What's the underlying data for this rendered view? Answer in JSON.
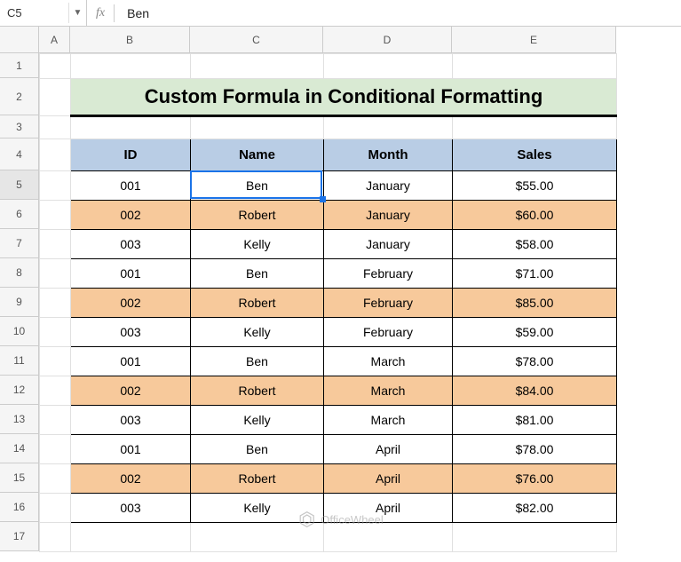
{
  "nameBox": "C5",
  "formulaValue": "Ben",
  "fxLabel": "fx",
  "columns": [
    {
      "label": "A",
      "width": 35
    },
    {
      "label": "B",
      "width": 135
    },
    {
      "label": "C",
      "width": 150
    },
    {
      "label": "D",
      "width": 145
    },
    {
      "label": "E",
      "width": 185
    }
  ],
  "rows": [
    {
      "label": "1",
      "height": 28
    },
    {
      "label": "2",
      "height": 42
    },
    {
      "label": "3",
      "height": 26
    },
    {
      "label": "4",
      "height": 36
    },
    {
      "label": "5",
      "height": 33,
      "active": true
    },
    {
      "label": "6",
      "height": 33
    },
    {
      "label": "7",
      "height": 33
    },
    {
      "label": "8",
      "height": 33
    },
    {
      "label": "9",
      "height": 33
    },
    {
      "label": "10",
      "height": 33
    },
    {
      "label": "11",
      "height": 33
    },
    {
      "label": "12",
      "height": 33
    },
    {
      "label": "13",
      "height": 33
    },
    {
      "label": "14",
      "height": 33
    },
    {
      "label": "15",
      "height": 33
    },
    {
      "label": "16",
      "height": 33
    },
    {
      "label": "17",
      "height": 33
    }
  ],
  "title": "Custom Formula in Conditional Formatting",
  "tableHeaders": [
    "ID",
    "Name",
    "Month",
    "Sales"
  ],
  "tableData": [
    {
      "id": "001",
      "name": "Ben",
      "month": "January",
      "sales": "$55.00",
      "hl": false
    },
    {
      "id": "002",
      "name": "Robert",
      "month": "January",
      "sales": "$60.00",
      "hl": true
    },
    {
      "id": "003",
      "name": "Kelly",
      "month": "January",
      "sales": "$58.00",
      "hl": false
    },
    {
      "id": "001",
      "name": "Ben",
      "month": "February",
      "sales": "$71.00",
      "hl": false
    },
    {
      "id": "002",
      "name": "Robert",
      "month": "February",
      "sales": "$85.00",
      "hl": true
    },
    {
      "id": "003",
      "name": "Kelly",
      "month": "February",
      "sales": "$59.00",
      "hl": false
    },
    {
      "id": "001",
      "name": "Ben",
      "month": "March",
      "sales": "$78.00",
      "hl": false
    },
    {
      "id": "002",
      "name": "Robert",
      "month": "March",
      "sales": "$84.00",
      "hl": true
    },
    {
      "id": "003",
      "name": "Kelly",
      "month": "March",
      "sales": "$81.00",
      "hl": false
    },
    {
      "id": "001",
      "name": "Ben",
      "month": "April",
      "sales": "$78.00",
      "hl": false
    },
    {
      "id": "002",
      "name": "Robert",
      "month": "April",
      "sales": "$76.00",
      "hl": true
    },
    {
      "id": "003",
      "name": "Kelly",
      "month": "April",
      "sales": "$82.00",
      "hl": false
    }
  ],
  "activeCell": {
    "row": 5,
    "col": "C"
  },
  "watermark": "OfficeWheel",
  "chart_data": {
    "type": "table",
    "title": "Custom Formula in Conditional Formatting",
    "columns": [
      "ID",
      "Name",
      "Month",
      "Sales"
    ],
    "rows": [
      [
        "001",
        "Ben",
        "January",
        "$55.00"
      ],
      [
        "002",
        "Robert",
        "January",
        "$60.00"
      ],
      [
        "003",
        "Kelly",
        "January",
        "$58.00"
      ],
      [
        "001",
        "Ben",
        "February",
        "$71.00"
      ],
      [
        "002",
        "Robert",
        "February",
        "$85.00"
      ],
      [
        "003",
        "Kelly",
        "February",
        "$59.00"
      ],
      [
        "001",
        "Ben",
        "March",
        "$78.00"
      ],
      [
        "002",
        "Robert",
        "March",
        "$84.00"
      ],
      [
        "003",
        "Kelly",
        "March",
        "$81.00"
      ],
      [
        "001",
        "Ben",
        "April",
        "$78.00"
      ],
      [
        "002",
        "Robert",
        "April",
        "$76.00"
      ],
      [
        "003",
        "Kelly",
        "April",
        "$82.00"
      ]
    ]
  }
}
